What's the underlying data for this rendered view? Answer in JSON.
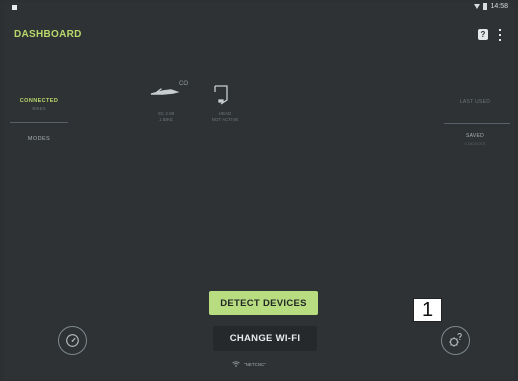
{
  "status_bar": {
    "time": "14:58"
  },
  "header": {
    "title": "DASHBOARD",
    "help_glyph": "?"
  },
  "left_nav": {
    "connected_label": "CONNECTED",
    "connected_sub": "BIKES",
    "modes_label": "MODES"
  },
  "right_nav": {
    "last_used_label": "LAST USED",
    "last_used_sub": "",
    "saved_label": "SAVED",
    "saved_sub": "",
    "saved_sub_text": "0 DEVICES"
  },
  "devices": {
    "separator": "CO",
    "bike_label_1": "SC 2.98",
    "bike_label_2": "1 BIKE",
    "head_label_1": "HEAD",
    "head_label_2": "NOT ACTIVE"
  },
  "buttons": {
    "detect": "DETECT DEVICES",
    "change_wifi": "CHANGE WI-FI"
  },
  "wifi": {
    "network": "\"NETCNC\""
  },
  "annotation": {
    "marker_label": "1"
  },
  "icons": {
    "status_left": "notification-square-icon",
    "status_wifi": "wifi-icon",
    "status_battery": "battery-icon",
    "help": "help-icon",
    "menu": "overflow-menu-icon",
    "gauge": "speedometer-icon",
    "settings": "settings-question-icon",
    "wifi_small": "wifi-icon"
  },
  "colors": {
    "accent": "#b9d86a",
    "background": "#2e3235",
    "detect_button": "#b8dc80",
    "wifi_button": "#25292b"
  }
}
